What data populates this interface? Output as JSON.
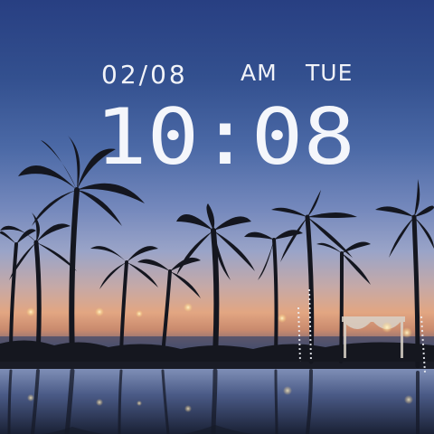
{
  "clock": {
    "date": "02/08",
    "ampm": "AM",
    "weekday": "TUE",
    "time": "10:08"
  },
  "colors": {
    "clock_text": "#f4f6fb",
    "sky_top": "#283f82",
    "horizon": "#e2a682"
  },
  "icons": [
    "palm-tree-silhouette",
    "pool-reflection"
  ]
}
